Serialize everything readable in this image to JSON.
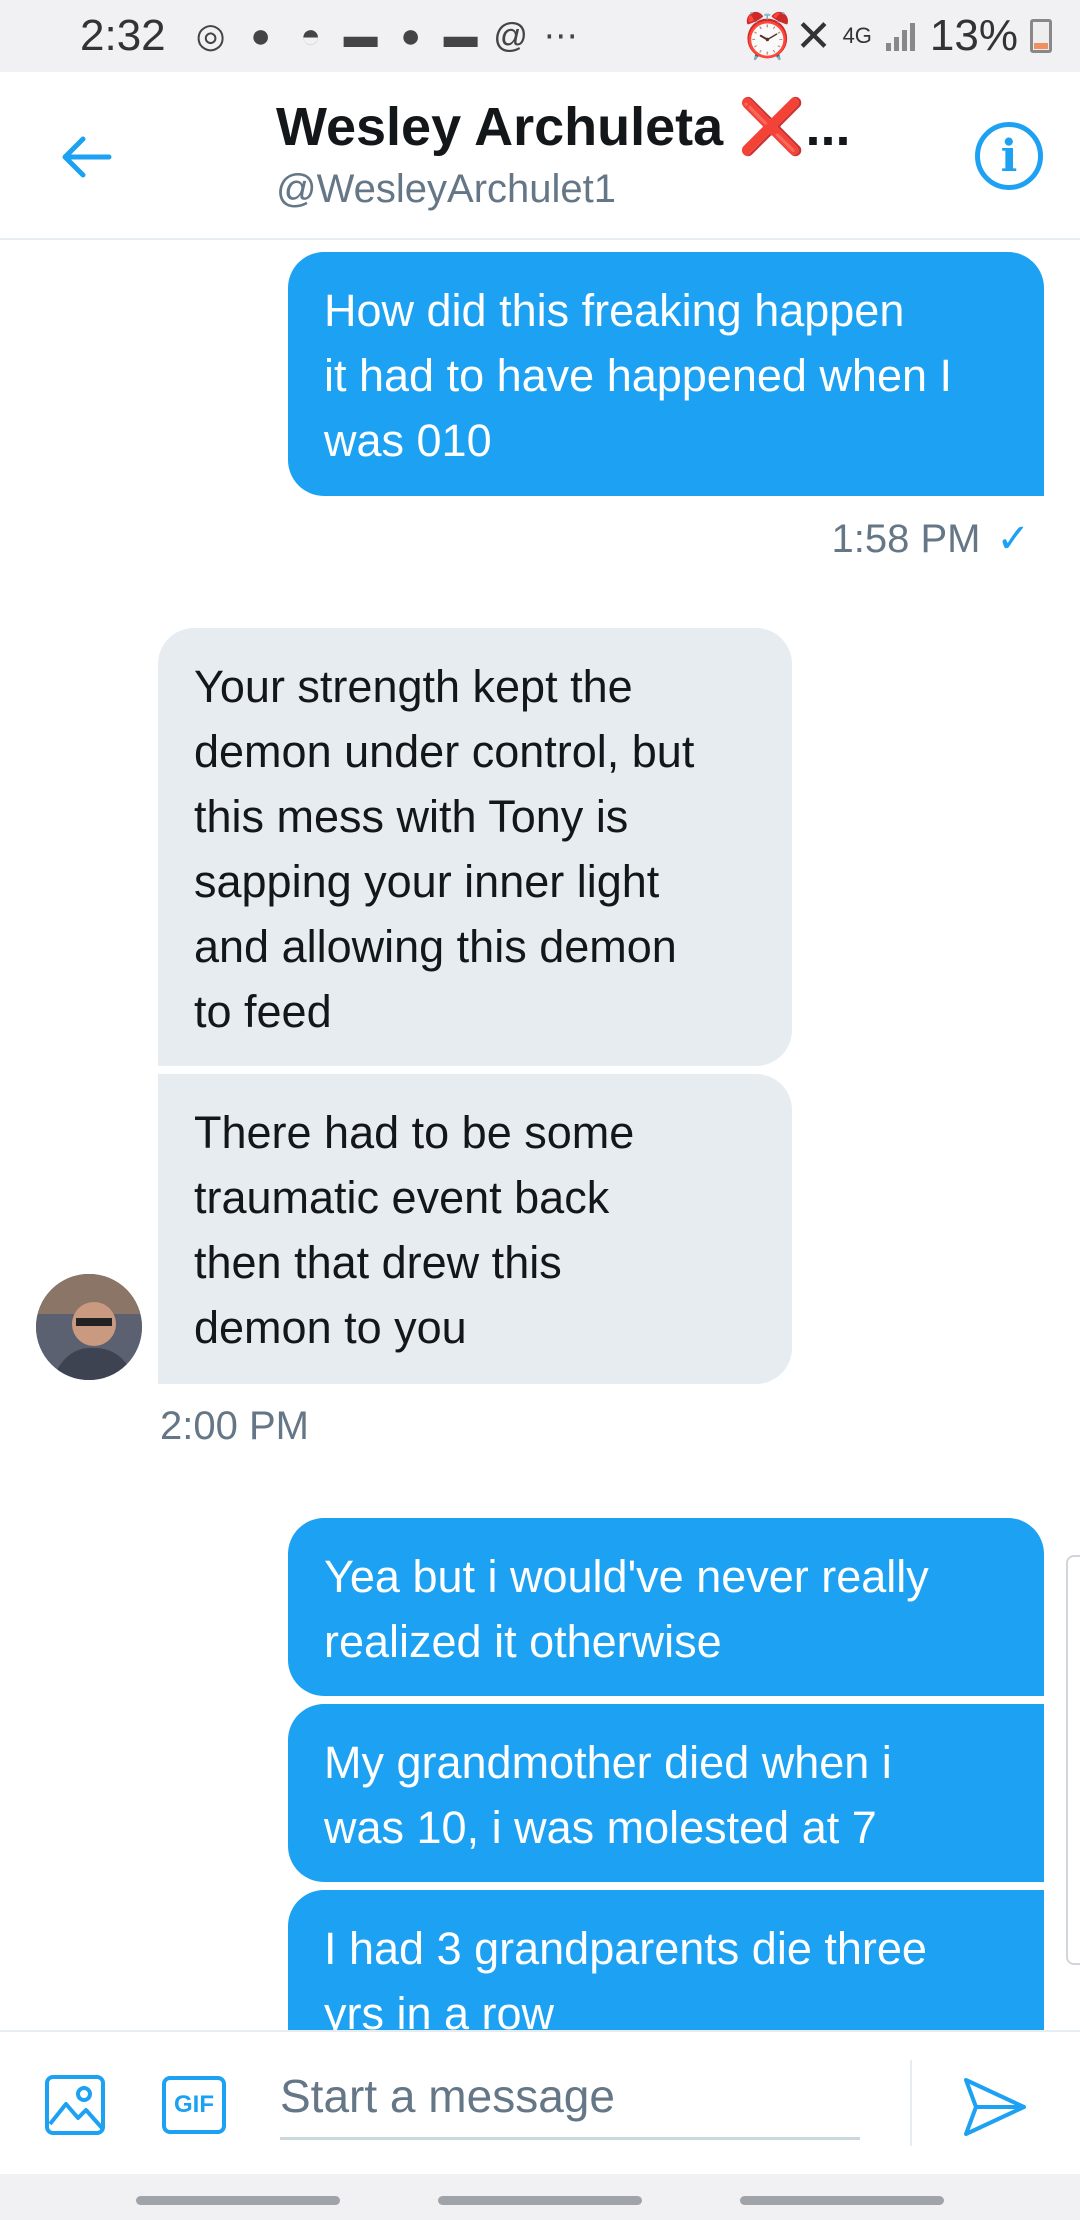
{
  "status_bar": {
    "time": "2:32",
    "battery": "13%",
    "network": "4G"
  },
  "header": {
    "name": "Wesley Archuleta",
    "name_emoji": "❌",
    "ellipsis": "...",
    "handle": "@WesleyArchulet1"
  },
  "messages": [
    {
      "side": "out",
      "text": "How did this freaking happen\nit had to have happened when I\nwas 010"
    },
    {
      "side": "in",
      "text": "Your strength kept the\ndemon under control, but\nthis mess with Tony is\nsapping your inner light\nand allowing this demon\nto feed"
    },
    {
      "side": "in",
      "text": "There had to be some\ntraumatic event back\nthen that drew this\ndemon to you"
    },
    {
      "side": "out",
      "text": "Yea but i would've never really\nrealized it otherwise"
    },
    {
      "side": "out",
      "text": "My grandmother died when i\nwas 10, i was molested at 7"
    },
    {
      "side": "out",
      "text": "I had 3 grandparents die three\nyrs in a row"
    }
  ],
  "timestamps": {
    "first": "1:58 PM",
    "first_check": "✓",
    "second": "2:00 PM"
  },
  "composer": {
    "gif_label": "GIF",
    "placeholder": "Start a message"
  },
  "colors": {
    "accent": "#1da1f2",
    "incoming_bubble": "#e6ecf0",
    "secondary_text": "#657786"
  }
}
